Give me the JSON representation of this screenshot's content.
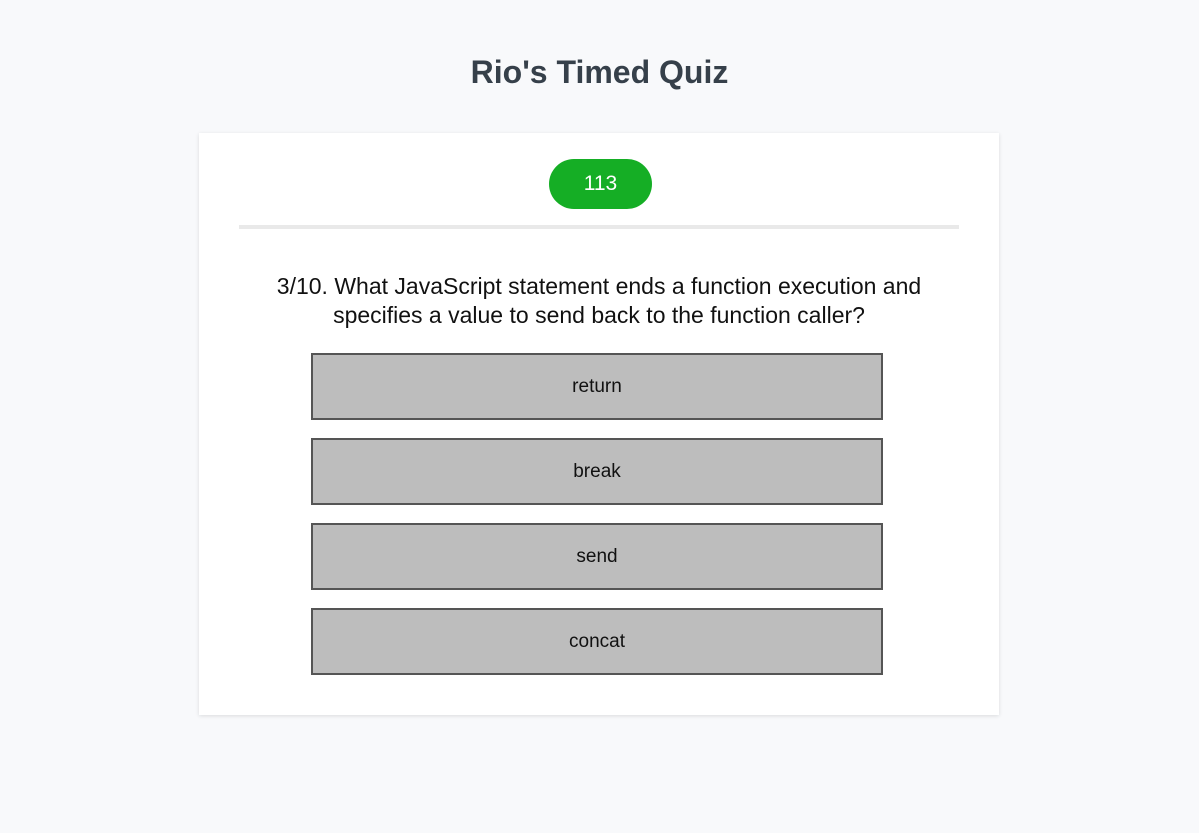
{
  "page": {
    "title": "Rio's Timed Quiz"
  },
  "quiz": {
    "timer": "113",
    "question": "3/10. What JavaScript statement ends a function execution and specifies a value to send back to the function caller?",
    "answers": [
      "return",
      "break",
      "send",
      "concat"
    ]
  },
  "colors": {
    "timer_bg": "#15ae25",
    "answer_bg": "#bdbdbd",
    "title": "#36404a"
  }
}
